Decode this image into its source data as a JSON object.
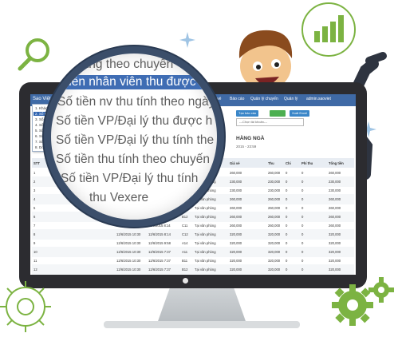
{
  "menu": {
    "brand": "Sao Việt",
    "topbar_items": [
      "Giá vé",
      "Báo cáo",
      "Quản lý chuyến",
      "Quản lý",
      "admin.saoviet"
    ],
    "dropdown_items": [
      "1. Khách hàng theo chuyến",
      "2. Số tiền nhân viên thu được",
      "3. Số tiền nv thu tính theo ngày",
      "4. Số tiền VP/Đại lý thu được",
      "5. Số tiền VP/Đại lý thu tính theo",
      "6. Số tiền thu tính theo chuyến",
      "7. Số tiền VP/Đại lý thu tính",
      "8. Doanh thu Vexere"
    ]
  },
  "controls": {
    "create_report": "Tạo báo cáo",
    "export": "Xuất Excel",
    "select_placeholder": "---Chọn tài khoản---"
  },
  "report": {
    "title": "HÀNG NGÀ",
    "subtitle": "2015 - 23:59"
  },
  "magnifier": {
    "lines": [
      "hàng theo chuyến",
      "tiền nhân viên thu được",
      "Số tiền nv thu tính theo ngày",
      "Số tiền VP/Đại lý thu được h",
      "Số tiền VP/Đại lý thu tính the",
      "Số tiền thu tính theo chuyến",
      "Số tiền VP/Đại lý thu tính",
      "thu Vexere"
    ]
  },
  "table": {
    "headers": [
      "STT",
      "Nhân viên",
      "",
      "",
      "Ghế",
      "",
      "Giá vé",
      "Thu",
      "Chi",
      "Phí thu",
      "Tổng tiền"
    ],
    "rows": [
      [
        "1",
        "hoangthien.saoviet",
        "",
        "",
        "B11",
        "Tại văn phòng",
        "260,000",
        "260,000",
        "0",
        "0",
        "260,000"
      ],
      [
        "2",
        "",
        "",
        "",
        "B05",
        "Tại văn phòng",
        "230,000",
        "230,000",
        "0",
        "0",
        "230,000"
      ],
      [
        "3",
        "",
        "",
        "",
        "B05",
        "Tại văn phòng",
        "230,000",
        "230,000",
        "0",
        "0",
        "230,000"
      ],
      [
        "4",
        "",
        "",
        "",
        "C16",
        "Tại văn phòng",
        "260,000",
        "260,000",
        "0",
        "0",
        "260,000"
      ],
      [
        "5",
        "",
        "11/6/2015 10:00",
        "11/6/2015 7:38",
        "B10",
        "Tại văn phòng",
        "260,000",
        "260,000",
        "0",
        "0",
        "260,000"
      ],
      [
        "6",
        "",
        "11/6/2015 10:00",
        "11/6/2015 7:39",
        "B12",
        "Tại văn phòng",
        "260,000",
        "260,000",
        "0",
        "0",
        "260,000"
      ],
      [
        "7",
        "",
        "11/6/2015 10:00",
        "11/6/2015 8:14",
        "C11",
        "Tại văn phòng",
        "260,000",
        "260,000",
        "0",
        "0",
        "260,000"
      ],
      [
        "8",
        "",
        "12/6/2015 10:30",
        "12/6/2015 8:14",
        "C12",
        "Tại văn phòng",
        "320,000",
        "320,000",
        "0",
        "0",
        "320,000"
      ],
      [
        "9",
        "",
        "12/6/2015 10:30",
        "12/6/2015 9:58",
        "A14",
        "Tại văn phòng",
        "320,000",
        "320,000",
        "0",
        "0",
        "320,000"
      ],
      [
        "10",
        "",
        "12/6/2015 10:30",
        "12/6/2015 7:37",
        "A11",
        "Tại văn phòng",
        "320,000",
        "320,000",
        "0",
        "0",
        "320,000"
      ],
      [
        "11",
        "",
        "12/6/2015 10:30",
        "12/6/2015 7:37",
        "B11",
        "Tại văn phòng",
        "320,000",
        "320,000",
        "0",
        "0",
        "320,000"
      ],
      [
        "12",
        "",
        "12/6/2015 10:30",
        "12/6/2015 7:37",
        "B12",
        "Tại văn phòng",
        "320,000",
        "320,000",
        "0",
        "0",
        "320,000"
      ],
      [
        "13",
        "",
        "12/6/2015 10:30",
        "12/6/2015 7:37",
        "B12",
        "Tại văn phòng",
        "320,000",
        "320,000",
        "0",
        "0",
        "320,000"
      ]
    ]
  },
  "colors": {
    "topbar": "#3f6aa6",
    "highlight": "#3f6db4",
    "green": "#7cb342",
    "button_blue": "#3a86c8",
    "button_green": "#4caf50"
  },
  "icons": [
    "search-icon",
    "bar-chart-icon",
    "gear-icon",
    "sparkle-icon"
  ]
}
